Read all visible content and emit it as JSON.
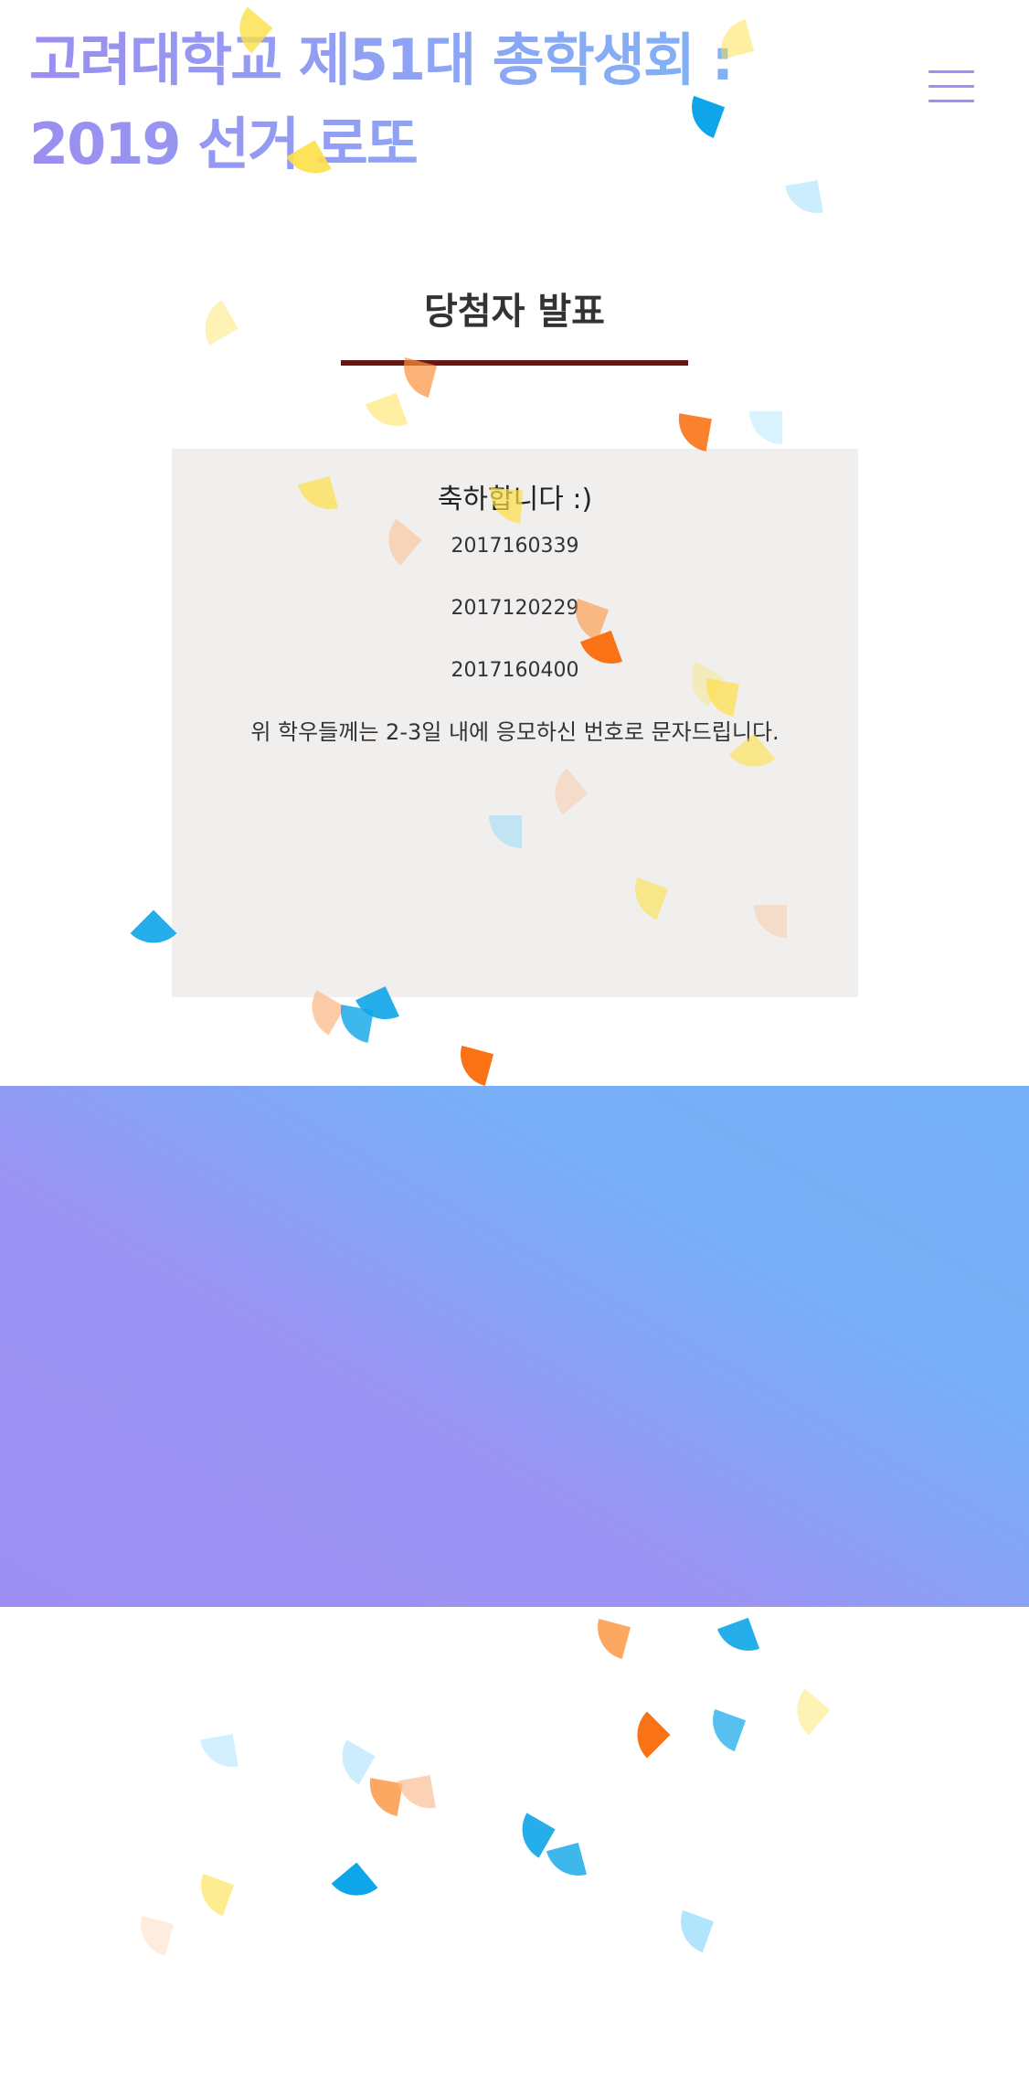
{
  "header": {
    "site_title": "고려대학교 제51대 총학생회 :\n2019 선거 로또",
    "menu_icon": "hamburger-menu-icon"
  },
  "main": {
    "section_title": "당첨자 발표",
    "box_heading": "축하합니다 :)",
    "winners": [
      "2017160339",
      "2017120229",
      "2017160400"
    ],
    "notice": "위 학우들께는 2-3일 내에 응모하신 번호로 문자드립니다."
  },
  "colors": {
    "title_gradient_start": "#9b8ef0",
    "title_gradient_end": "#7fb2f6",
    "underline": "#6b1414",
    "box_background": "#f0efee",
    "band_gradient_start": "#9d8ff2",
    "band_gradient_end": "#76b0f6",
    "confetti": [
      "#fde047",
      "#fb923c",
      "#0ea5e9",
      "#f97316",
      "#fbbf94",
      "#7dd3fc"
    ]
  }
}
